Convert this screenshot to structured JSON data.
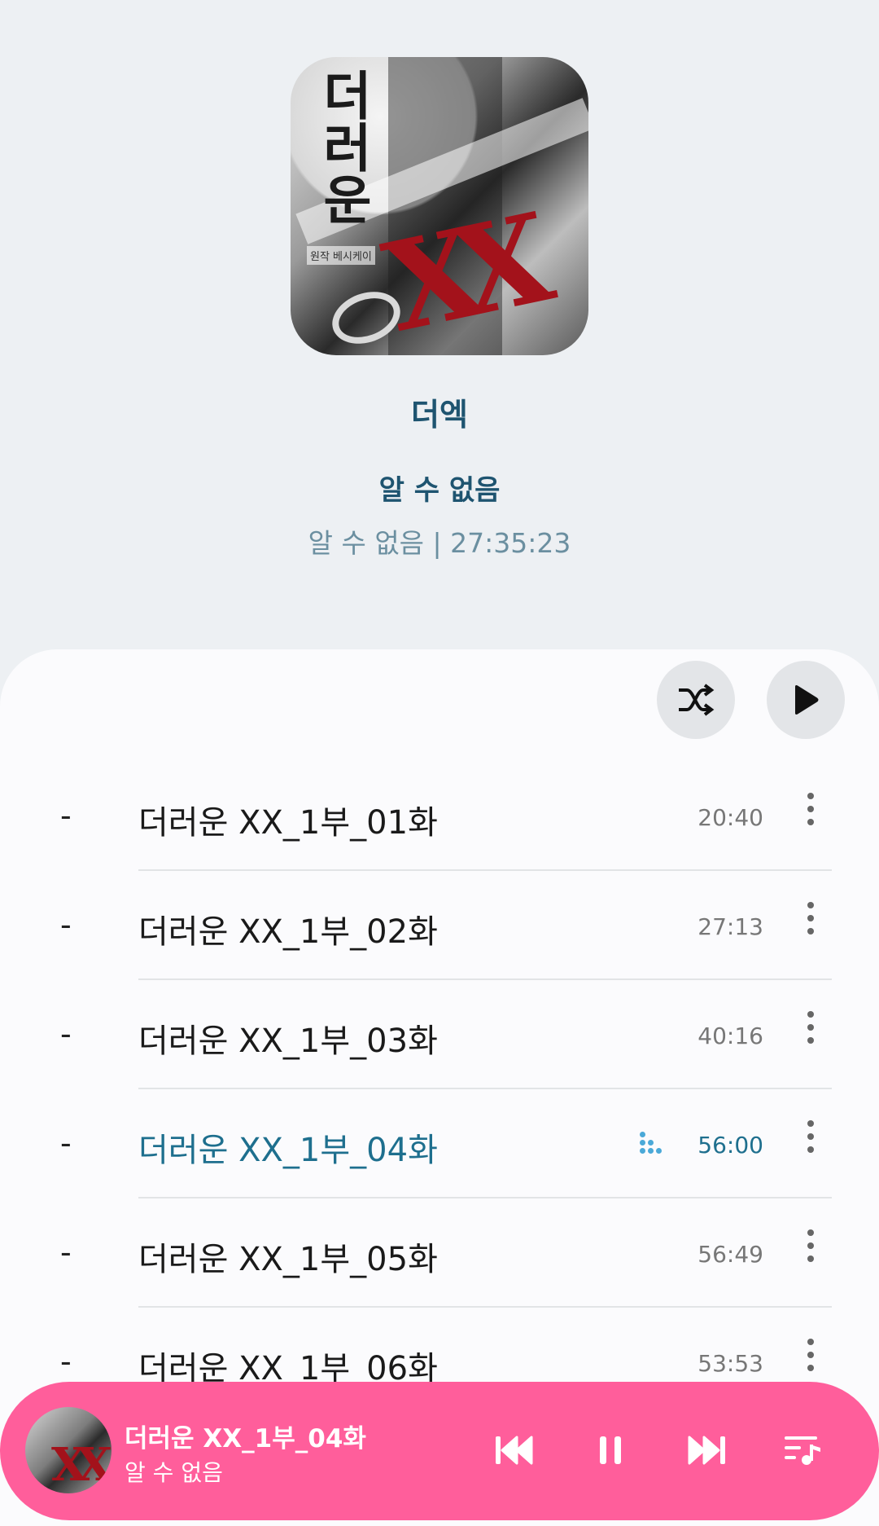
{
  "album": {
    "title": "더엑",
    "artist": "알 수 없음",
    "meta": "알 수 없음 | 27:35:23",
    "art_credit": "원작 베시케이"
  },
  "actions": {
    "shuffle_icon": "shuffle-icon",
    "play_icon": "play-icon"
  },
  "tracks": [
    {
      "index": "-",
      "title": "더러운 XX_1부_01화",
      "duration": "20:40"
    },
    {
      "index": "-",
      "title": "더러운 XX_1부_02화",
      "duration": "27:13"
    },
    {
      "index": "-",
      "title": "더러운 XX_1부_03화",
      "duration": "40:16"
    },
    {
      "index": "-",
      "title": "더러운 XX_1부_04화",
      "duration": "56:00",
      "playing": true
    },
    {
      "index": "-",
      "title": "더러운 XX_1부_05화",
      "duration": "56:49"
    },
    {
      "index": "-",
      "title": "더러운 XX_1부_06화",
      "duration": "53:53"
    }
  ],
  "mini_player": {
    "title": "더러운 XX_1부_04화",
    "artist": "알 수 없음",
    "controls": [
      "skip-previous-icon",
      "pause-icon",
      "skip-next-icon",
      "queue-music-icon"
    ]
  },
  "colors": {
    "accent": "#1e6f8e",
    "mini_player_bg": "#ff5e9b",
    "panel_bg": "#fbfbfd",
    "page_bg": "#edf0f3"
  }
}
